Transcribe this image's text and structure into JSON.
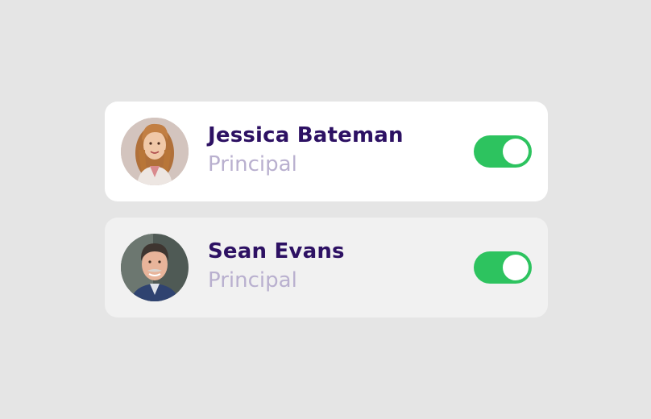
{
  "colors": {
    "background": "#e5e5e5",
    "card_active": "#ffffff",
    "card_inactive": "#f1f1f1",
    "name_text": "#2d1163",
    "role_text": "#b9b0cf",
    "toggle_on": "#2dc35f"
  },
  "users": [
    {
      "name": "Jessica Bateman",
      "role": "Principal",
      "toggle_on": true,
      "avatar": "avatar-photo-jessica"
    },
    {
      "name": "Sean Evans",
      "role": "Principal",
      "toggle_on": true,
      "avatar": "avatar-photo-sean"
    }
  ]
}
